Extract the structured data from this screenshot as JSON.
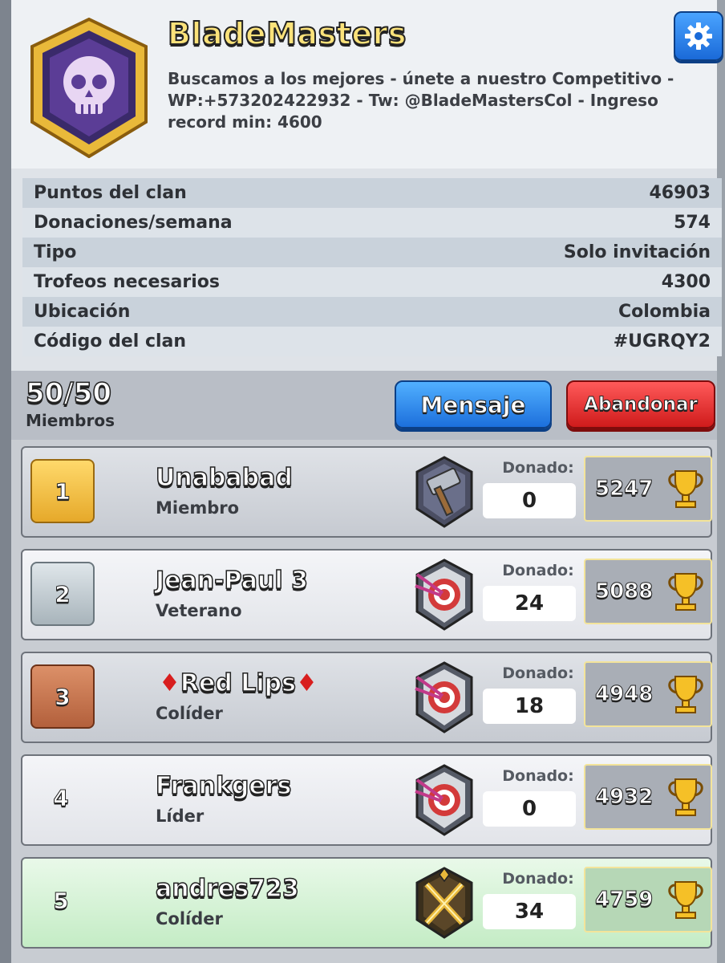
{
  "clan": {
    "name": "BladeMasters",
    "description": "Buscamos a los mejores - únete a nuestro Competitivo - WP:+573202422932 - Tw: @BladeMastersCol - Ingreso record min: 4600"
  },
  "stats": [
    {
      "label": "Puntos del clan",
      "value": "46903"
    },
    {
      "label": "Donaciones/semana",
      "value": "574"
    },
    {
      "label": "Tipo",
      "value": "Solo invitación"
    },
    {
      "label": "Trofeos necesarios",
      "value": "4300"
    },
    {
      "label": "Ubicación",
      "value": "Colombia"
    },
    {
      "label": "Código del clan",
      "value": "#UGRQY2"
    }
  ],
  "members_bar": {
    "count": "50/50",
    "label": "Miembros",
    "message_button": "Mensaje",
    "leave_button": "Abandonar"
  },
  "members": [
    {
      "rank": "1",
      "name": "Unababad",
      "role": "Miembro",
      "donated_label": "Donado:",
      "donated": "0",
      "trophies": "5247",
      "arena_icon": "hammer-arena-icon",
      "rank_color": "#f2c24a"
    },
    {
      "rank": "2",
      "name": "Jean-Paul 3",
      "role": "Veterano",
      "donated_label": "Donado:",
      "donated": "24",
      "trophies": "5088",
      "arena_icon": "target-arena-icon",
      "rank_color": "#bfc9cf"
    },
    {
      "rank": "3",
      "name": "Red Lips",
      "role": "Colíder",
      "donated_label": "Donado:",
      "donated": "18",
      "trophies": "4948",
      "arena_icon": "target-arena-icon",
      "rank_color": "#c77a55"
    },
    {
      "rank": "4",
      "name": "Frankgers",
      "role": "Líder",
      "donated_label": "Donado:",
      "donated": "0",
      "trophies": "4932",
      "arena_icon": "target-arena-icon"
    },
    {
      "rank": "5",
      "name": "andres723",
      "role": "Colíder",
      "donated_label": "Donado:",
      "donated": "34",
      "trophies": "4759",
      "arena_icon": "crossed-swords-arena-icon"
    }
  ],
  "colors": {
    "accent_blue": "#1c6fdc",
    "leave_red": "#cf1b1b",
    "name_yellow": "#fbe27a",
    "highlight_green": "#c4ecc5"
  }
}
